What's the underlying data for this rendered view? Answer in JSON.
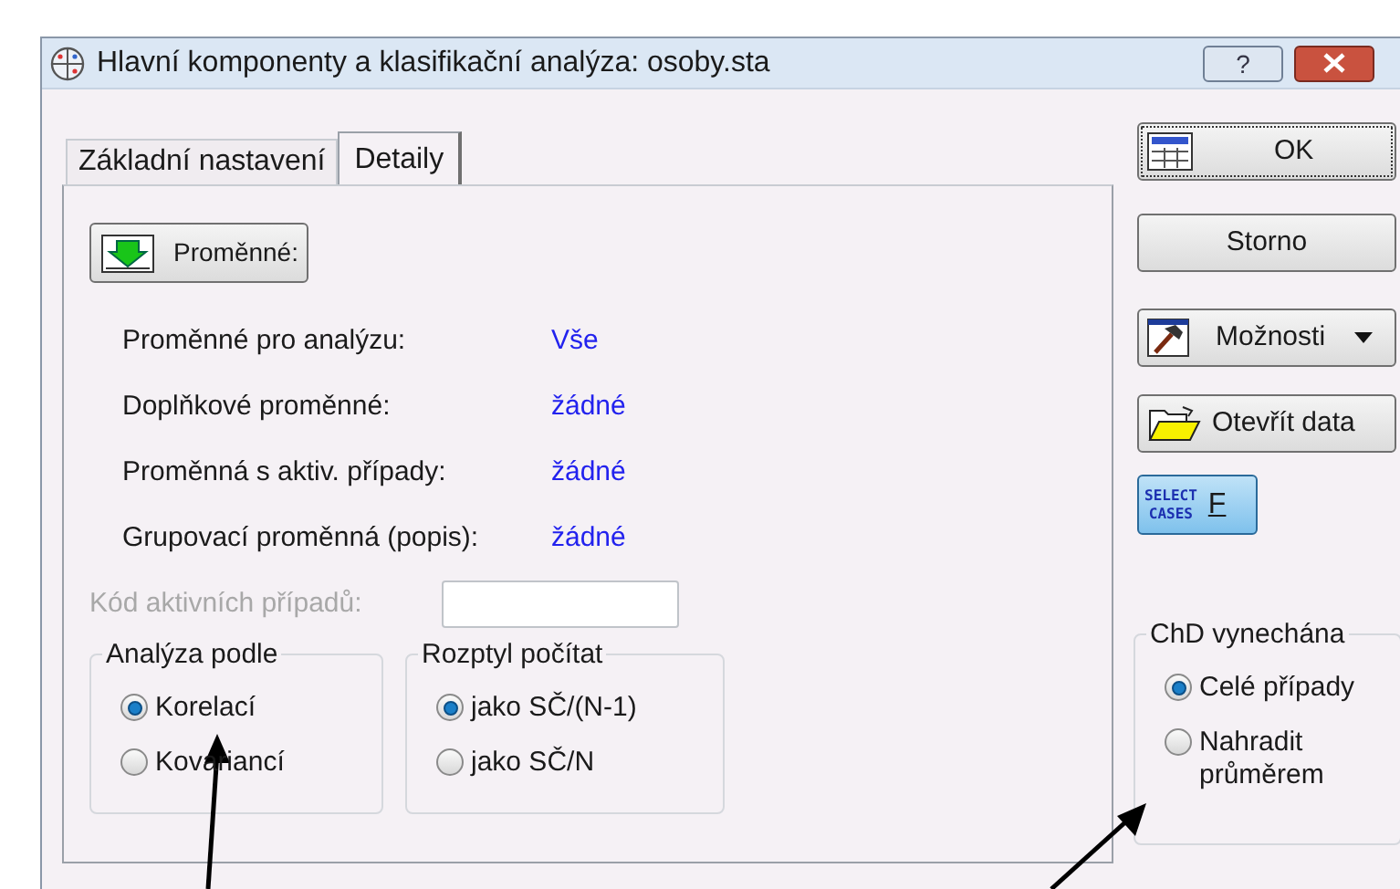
{
  "window": {
    "title": "Hlavní komponenty a klasifikační analýza: osoby.sta",
    "help": "?"
  },
  "tabs": [
    {
      "label": "Základní nastavení",
      "selected": false
    },
    {
      "label": "Detaily",
      "selected": true
    }
  ],
  "variables_button": "Proměnné:",
  "variables": [
    {
      "label": "Proměnné pro analýzu:",
      "value": "Vše"
    },
    {
      "label": "Doplňkové proměnné:",
      "value": "žádné"
    },
    {
      "label": "Proměnná s aktiv. případy:",
      "value": "žádné"
    },
    {
      "label": "Grupovací proměnná (popis):",
      "value": "žádné"
    }
  ],
  "active_cases_code": {
    "label": "Kód aktivních případů:",
    "disabled": true
  },
  "groups": [
    {
      "title": "Analýza podle",
      "options": [
        {
          "label": "Korelací",
          "selected": true
        },
        {
          "label": "Kovariancí",
          "selected": false
        }
      ]
    },
    {
      "title": "Rozptyl počítat",
      "options": [
        {
          "label": "jako SČ/(N-1)",
          "selected": true
        },
        {
          "label": "jako SČ/N",
          "selected": false
        }
      ]
    }
  ],
  "buttons": [
    {
      "kind": "ok",
      "label": "OK"
    },
    {
      "kind": "plain",
      "label": "Storno"
    },
    {
      "kind": "options",
      "label": "Možnosti"
    },
    {
      "kind": "open",
      "label": "Otevřít data"
    },
    {
      "kind": "select",
      "label": "F",
      "icon_text": [
        "SELECT",
        "CASES"
      ]
    }
  ],
  "missing": {
    "title": "ChD vynechána",
    "options": [
      {
        "label": "Celé případy",
        "selected": true
      },
      {
        "label": "Nahradit průměrem",
        "selected": false
      }
    ]
  }
}
